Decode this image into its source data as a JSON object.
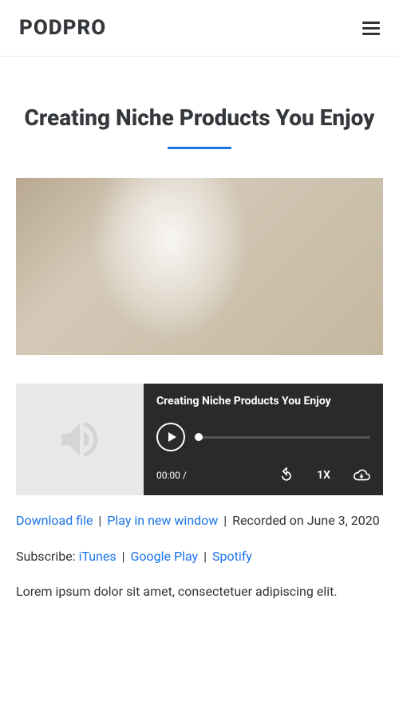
{
  "header": {
    "logo": "PODPRO"
  },
  "post": {
    "title": "Creating Niche Products You Enjoy",
    "player_title": "Creating Niche Products You Enjoy",
    "time_elapsed": "00:00 /",
    "speed": "1X",
    "download_label": "Download file",
    "play_window_label": "Play in new window",
    "recorded_prefix": "Recorded on ",
    "recorded_date": "June 3, 2020",
    "subscribe_label": "Subscribe: ",
    "subscribe": {
      "itunes": "iTunes",
      "google": "Google Play",
      "spotify": "Spotify"
    },
    "body": "Lorem ipsum dolor sit amet, consectetuer adipiscing elit."
  }
}
